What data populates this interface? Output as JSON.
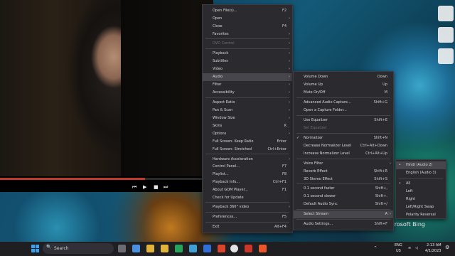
{
  "wallpaper": {
    "watermark": "Microsoft Bing"
  },
  "player": {
    "progress": 0.68,
    "controls": {
      "prev": "⏮",
      "play": "▶",
      "stop": "■",
      "next": "⏭"
    }
  },
  "main_menu": {
    "items": [
      {
        "label": "Open File(s)...",
        "shortcut": "F2"
      },
      {
        "label": "Open",
        "arrow": "›"
      },
      {
        "label": "Close",
        "shortcut": "F4"
      },
      {
        "label": "Favorites",
        "arrow": "›"
      },
      {
        "label": "DVD Control",
        "arrow": "›"
      },
      {
        "label": "Playback",
        "arrow": "›"
      },
      {
        "label": "Subtitles",
        "arrow": "›"
      },
      {
        "label": "Video",
        "arrow": "›"
      },
      {
        "label": "Audio",
        "arrow": "›"
      },
      {
        "label": "Filter",
        "arrow": "›"
      },
      {
        "label": "Accessibility",
        "arrow": "›"
      },
      {
        "label": "Aspect Ratio",
        "arrow": "›"
      },
      {
        "label": "Pan & Scan",
        "arrow": "›"
      },
      {
        "label": "Window Size",
        "arrow": "›"
      },
      {
        "label": "Skins",
        "shortcut": "K"
      },
      {
        "label": "Options",
        "arrow": "›"
      },
      {
        "label": "Full Screen: Keep Ratio",
        "shortcut": "Enter"
      },
      {
        "label": "Full Screen: Stretched",
        "shortcut": "Ctrl+Enter"
      },
      {
        "label": "Hardware Acceleration",
        "arrow": "›"
      },
      {
        "label": "Control Panel...",
        "shortcut": "F7"
      },
      {
        "label": "Playlist...",
        "shortcut": "F8"
      },
      {
        "label": "Playback Info...",
        "shortcut": "Ctrl+F1"
      },
      {
        "label": "About GOM Player...",
        "shortcut": "F1"
      },
      {
        "label": "Check for Update"
      },
      {
        "label": "Playback 360° video",
        "arrow": "›"
      },
      {
        "label": "Preferences...",
        "shortcut": "F5"
      },
      {
        "label": "Exit",
        "shortcut": "Alt+F4"
      }
    ]
  },
  "audio_menu": {
    "items": [
      {
        "label": "Volume Down",
        "shortcut": "Down"
      },
      {
        "label": "Volume Up",
        "shortcut": "Up"
      },
      {
        "label": "Mute On/Off",
        "shortcut": "M"
      },
      {
        "label": "Advanced Audio Capture...",
        "shortcut": "Shift+G"
      },
      {
        "label": "Open a Capture Folder..."
      },
      {
        "label": "Use Equalizer",
        "shortcut": "Shift+E"
      },
      {
        "label": "Set Equalizer"
      },
      {
        "label": "Normalizer",
        "shortcut": "Shift+N",
        "check": "✓"
      },
      {
        "label": "Decrease Normalizer Level",
        "shortcut": "Ctrl+Alt+Down"
      },
      {
        "label": "Increase Normalizer Level",
        "shortcut": "Ctrl+Alt+Up"
      },
      {
        "label": "Voice Filter",
        "arrow": "›"
      },
      {
        "label": "Reverb Effect",
        "shortcut": "Shift+R"
      },
      {
        "label": "3D Stereo Effect",
        "shortcut": "Shift+S"
      },
      {
        "label": "0.1 second faster",
        "shortcut": "Shift+,"
      },
      {
        "label": "0.1 second slower",
        "shortcut": "Shift+."
      },
      {
        "label": "Default Audio Sync",
        "shortcut": "Shift+/"
      },
      {
        "label": "Select Stream",
        "shortcut": "A",
        "arrow": "›"
      },
      {
        "label": "Audio Settings...",
        "shortcut": "Shift+F"
      }
    ]
  },
  "stream_menu": {
    "items": [
      {
        "label": "Hindi (Audio 2)",
        "check": "•"
      },
      {
        "label": "English (Audio 3)"
      },
      {
        "label": "All",
        "check": "•"
      },
      {
        "label": "Left"
      },
      {
        "label": "Right"
      },
      {
        "label": "Left/Right Swap"
      },
      {
        "label": "Polarity Reversal"
      }
    ]
  },
  "taskbar": {
    "search_placeholder": "Search",
    "search_icon": "🔍",
    "start_icon": "start-icon",
    "language": "ENG",
    "region": "US",
    "time": "2:13 AM",
    "date": "4/1/2023",
    "chevron": "^",
    "colors": {
      "taskbar": "#1f1f22",
      "menu": "#2b2b2f",
      "highlight": "#46464c"
    }
  }
}
